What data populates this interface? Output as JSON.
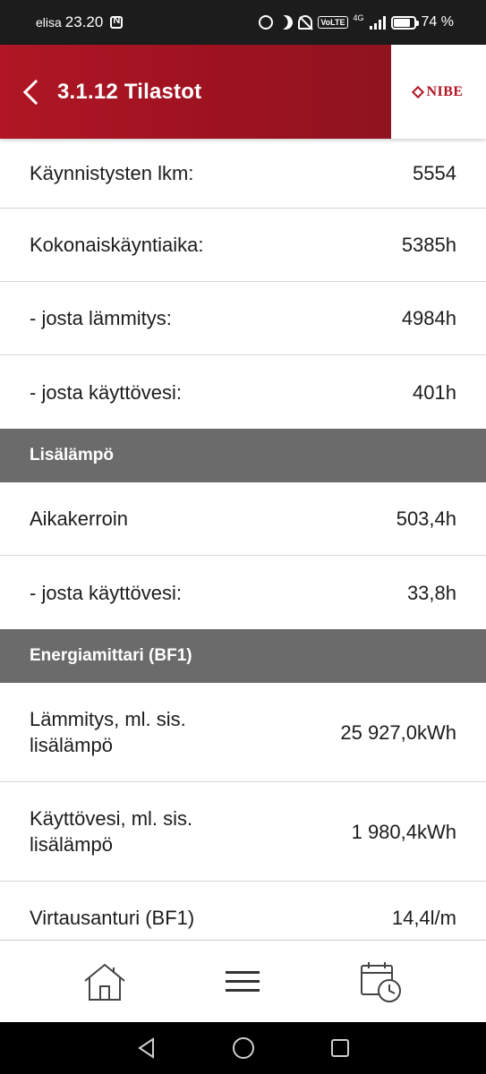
{
  "status_bar": {
    "carrier": "elisa",
    "time": "23.20",
    "network": "4G",
    "volte": "VoLTE",
    "battery": "74 %"
  },
  "header": {
    "title": "3.1.12 Tilastot",
    "logo_text": "NIBE"
  },
  "rows_top": [
    {
      "label": "Käynnistysten lkm:",
      "value": "5554"
    },
    {
      "label": "Kokonaiskäyntiaika:",
      "value": "5385h"
    },
    {
      "label": "- josta lämmitys:",
      "value": "4984h"
    },
    {
      "label": "- josta käyttövesi:",
      "value": "401h"
    }
  ],
  "section_1": {
    "title": "Lisälämpö",
    "rows": [
      {
        "label": "Aikakerroin",
        "value": "503,4h"
      },
      {
        "label": "- josta käyttövesi:",
        "value": "33,8h"
      }
    ]
  },
  "section_2": {
    "title": "Energiamittari (BF1)",
    "rows": [
      {
        "label": "Lämmitys, ml. sis. lisälämpö",
        "value": "25 927,0kWh"
      },
      {
        "label": "Käyttövesi, ml. sis. lisälämpö",
        "value": "1 980,4kWh"
      },
      {
        "label": "Virtausanturi (BF1)",
        "value": "14,4l/m"
      }
    ]
  },
  "bottom_nav": {
    "items": [
      "home-icon",
      "menu-icon",
      "calendar-clock-icon"
    ]
  },
  "colors": {
    "header_red": "#b01625",
    "section_gray": "#6b6b6b",
    "status_bar": "#1c1c1c"
  }
}
